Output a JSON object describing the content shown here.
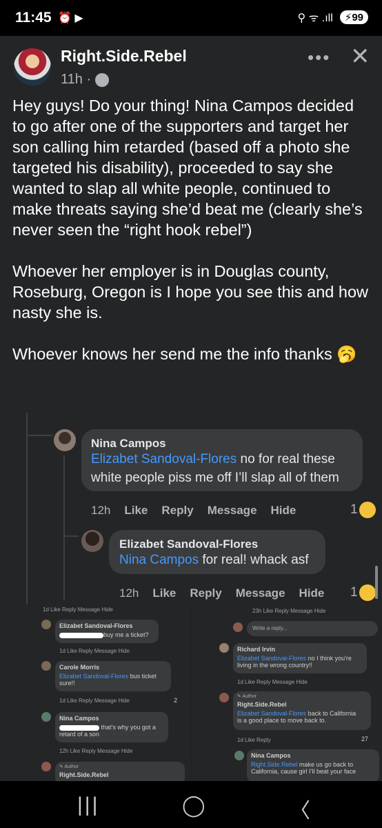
{
  "status": {
    "time": "11:45",
    "left_icons": "⏰ ▶",
    "right_icons": "⚲ ᯤ .ıll",
    "battery": "99"
  },
  "post": {
    "author": "Right.Side.Rebel",
    "time": "11h ·",
    "more_label": "•••",
    "close_label": "✕",
    "body": "Hey guys! Do your thing! Nina Campos decided to go after one of the supporters and target her son calling him retarded (based off a photo she targeted his disability), proceeded to say she wanted to slap all white people, continued to make threats saying she’d beat me (clearly she’s never seen the “right hook rebel”)\n\nWhoever her employer is in Douglas county, Roseburg, Oregon is I hope you see this and how nasty she is.\n\nWhoever knows her send me the info thanks"
  },
  "comments": [
    {
      "name": "Nina Campos",
      "mention": "Elizabet Sandoval-Flores",
      "text_line1": " no for real these",
      "text_line2": "white people piss me off I’ll slap all of them",
      "time": "12h",
      "actions": [
        "Like",
        "Reply",
        "Message",
        "Hide"
      ],
      "reactions": "1"
    },
    {
      "name": "Elizabet Sandoval-Flores",
      "mention": "Nina Campos",
      "text": " for real! whack asf",
      "time": "12h",
      "actions": [
        "Like",
        "Reply",
        "Message",
        "Hide"
      ],
      "reactions": "1"
    }
  ],
  "screenshots": {
    "left": {
      "top_actions": "1d   Like   Reply   Message   Hide",
      "c1_name": "Elizabet Sandoval-Flores",
      "c1_text": "buy me a ticket?",
      "c1_actions": "1d   Like   Reply   Message   Hide",
      "c2_name": "Carole Morris",
      "c2_mention": "Elizabet Sandoval-Flores",
      "c2_text1": " bus ticket",
      "c2_text2": "sure!!",
      "c2_actions": "1d   Like   Reply   Message   Hide",
      "c2_reactions": "2",
      "c3_name": "Nina Campos",
      "c3_text1": "that’s why you got a",
      "c3_text2": "retard of a son",
      "c3_actions": "12h   Like   Reply   Message   Hide",
      "c4_badge": "Author",
      "c4_name": "Right.Side.Rebel"
    },
    "right": {
      "top_actions": "23h   Like   Reply   Message   Hide",
      "reply_placeholder": "Write a reply...",
      "c1_name": "Richard Irvin",
      "c1_mention": "Elizabet Sandoval-Flores",
      "c1_text1": " no I think you're",
      "c1_text2": "living in the wrong country!!",
      "c1_actions": "1d   Like   Reply   Message   Hide",
      "c2_badge": "Author",
      "c2_name": "Right.Side.Rebel",
      "c2_mention": "Elizabet Sandoval-Flores",
      "c2_text1": " back to California",
      "c2_text2": "is a good place to move back to.",
      "c2_actions": "1d   Like   Reply",
      "c2_reactions": "27",
      "c3_name": "Nina Campos",
      "c3_mention": "Right.Side.Rebel",
      "c3_text1": " make us go back to",
      "c3_text2": "California, cause girl I’ll beat your face"
    }
  },
  "navbar": {
    "recents": "|||",
    "home": "◯",
    "back": "〈"
  }
}
